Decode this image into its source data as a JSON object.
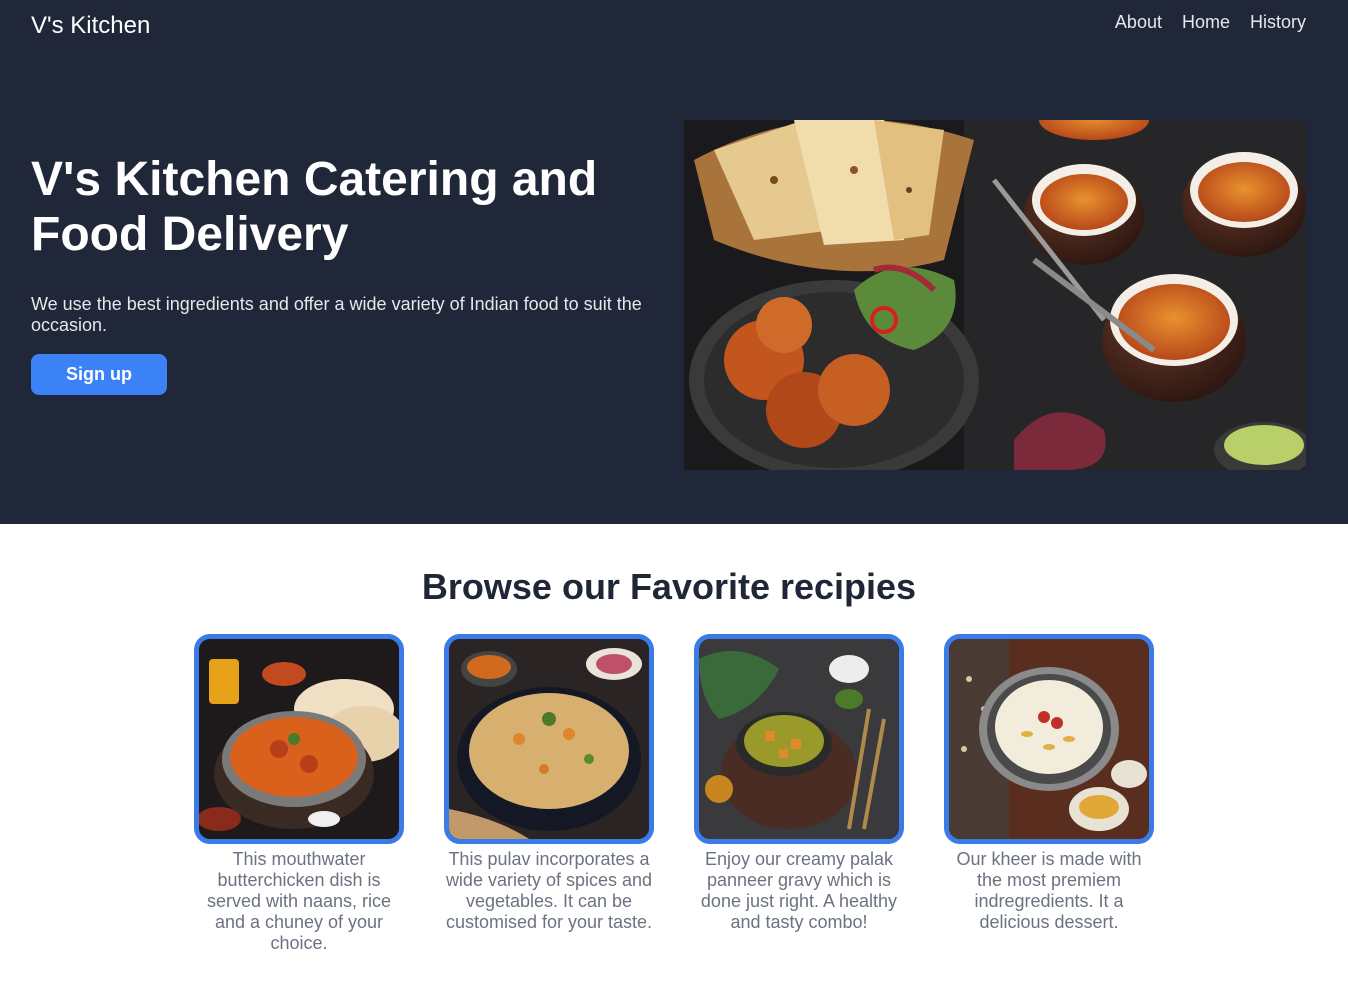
{
  "nav": {
    "brand": "V's Kitchen",
    "links": [
      "About",
      "Home",
      "History"
    ]
  },
  "hero": {
    "title": "V's Kitchen Catering and Food Delivery",
    "subtitle": "We use the best ingredients and offer a wide variety of Indian food to suit the occasion.",
    "cta_label": "Sign up"
  },
  "recipes": {
    "heading": "Browse our Favorite recipies",
    "items": [
      {
        "icon": "butter-chicken-image",
        "description": "This mouthwater butterchicken dish is served with naans, rice and a chuney of your choice."
      },
      {
        "icon": "pulav-image",
        "description": "This pulav incorporates a wide variety of spices and vegetables. It can be customised for your taste."
      },
      {
        "icon": "palak-paneer-image",
        "description": "Enjoy our creamy palak panneer gravy which is done just right. A healthy and tasty combo!"
      },
      {
        "icon": "kheer-image",
        "description": "Our kheer is made with the most premiem indregredients. It a delicious dessert."
      }
    ]
  },
  "colors": {
    "header_bg": "#1f2738",
    "accent": "#3b82f6",
    "card_border": "#3b7be8"
  }
}
